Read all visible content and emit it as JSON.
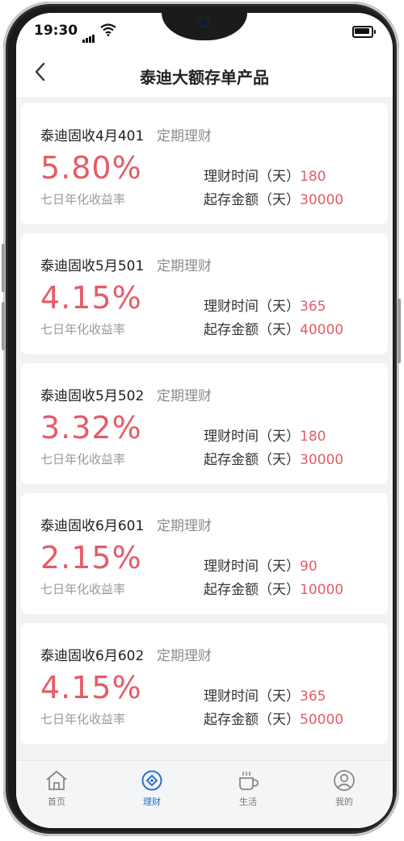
{
  "status_bar": {
    "time": "19:30"
  },
  "header": {
    "title": "泰迪大额存单产品"
  },
  "products": [
    {
      "name": "泰迪固收4月401",
      "type": "定期理财",
      "rate": "5.80%",
      "rate_label": "七日年化收益率",
      "term_label": "理财时间（天）",
      "term": "180",
      "min_label": "起存金额（天）",
      "min_amount": "30000"
    },
    {
      "name": "泰迪固收5月501",
      "type": "定期理财",
      "rate": "4.15%",
      "rate_label": "七日年化收益率",
      "term_label": "理财时间（天）",
      "term": "365",
      "min_label": "起存金额（天）",
      "min_amount": "40000"
    },
    {
      "name": "泰迪固收5月502",
      "type": "定期理财",
      "rate": "3.32%",
      "rate_label": "七日年化收益率",
      "term_label": "理财时间（天）",
      "term": "180",
      "min_label": "起存金额（天）",
      "min_amount": "30000"
    },
    {
      "name": "泰迪固收6月601",
      "type": "定期理财",
      "rate": "2.15%",
      "rate_label": "七日年化收益率",
      "term_label": "理财时间（天）",
      "term": "90",
      "min_label": "起存金额（天）",
      "min_amount": "10000"
    },
    {
      "name": "泰迪固收6月602",
      "type": "定期理财",
      "rate": "4.15%",
      "rate_label": "七日年化收益率",
      "term_label": "理财时间（天）",
      "term": "365",
      "min_label": "起存金额（天）",
      "min_amount": "50000"
    }
  ],
  "tabbar": {
    "items": [
      {
        "label": "首页",
        "icon": "home-icon"
      },
      {
        "label": "理财",
        "icon": "finance-icon",
        "active": true
      },
      {
        "label": "生活",
        "icon": "coffee-cup-icon"
      },
      {
        "label": "我的",
        "icon": "user-icon"
      }
    ]
  },
  "colors": {
    "accent_red": "#e55b67",
    "active_blue": "#2a6fd1"
  }
}
